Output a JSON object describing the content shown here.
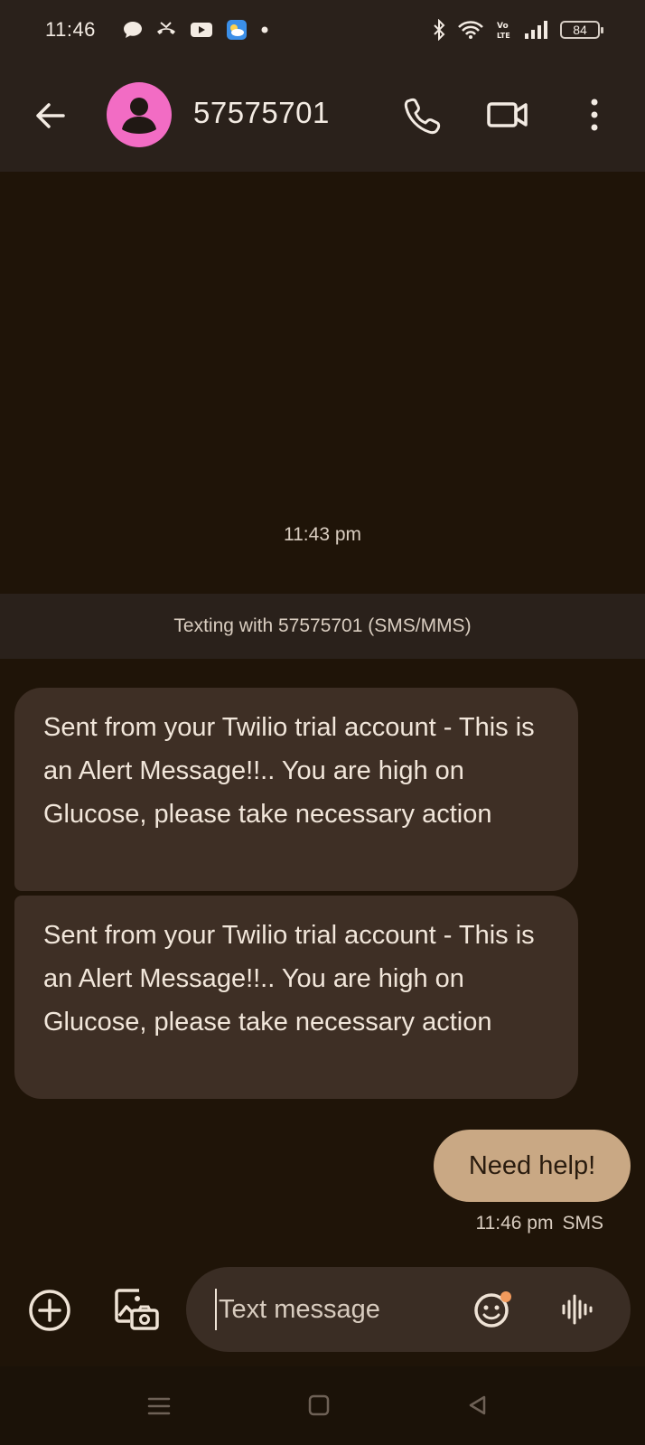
{
  "status_bar": {
    "time": "11:46",
    "battery": "84",
    "left_icons": [
      "chat-bubble-icon",
      "missed-call-icon",
      "youtube-icon",
      "weather-icon",
      "dot-icon"
    ],
    "right_icons": [
      "bluetooth-icon",
      "wifi-icon",
      "volte-icon",
      "signal-icon",
      "battery-icon"
    ]
  },
  "header": {
    "contact_name": "57575701",
    "avatar_color": "#f26cc4",
    "actions": [
      "back-arrow-icon",
      "phone-icon",
      "video-camera-icon",
      "more-vert-icon"
    ]
  },
  "conversation": {
    "timestamp": "11:43 pm",
    "texting_banner": "Texting with 57575701 (SMS/MMS)",
    "incoming_messages": [
      {
        "text": "Sent from your Twilio trial account - This is an Alert Message!!.. You are high on Glucose, please take necessary action"
      },
      {
        "text": "Sent from your Twilio trial account - This is an Alert Message!!.. You are high on Glucose, please take necessary action"
      }
    ],
    "outgoing_message": {
      "text": "Need help!",
      "time": "11:46 pm",
      "type": "SMS"
    }
  },
  "compose": {
    "placeholder": "Text message",
    "icons": [
      "add-circle-icon",
      "gallery-camera-icon",
      "emoji-icon",
      "voice-wave-icon"
    ]
  },
  "navigation": {
    "icons": [
      "menu-lines-icon",
      "home-square-icon",
      "back-triangle-icon"
    ]
  },
  "colors": {
    "background": "#1f1408",
    "bar": "#2a211b",
    "incoming_bubble": "#3e2f25",
    "outgoing_bubble": "#c9a884",
    "notification_accent": "#f29a5c"
  }
}
